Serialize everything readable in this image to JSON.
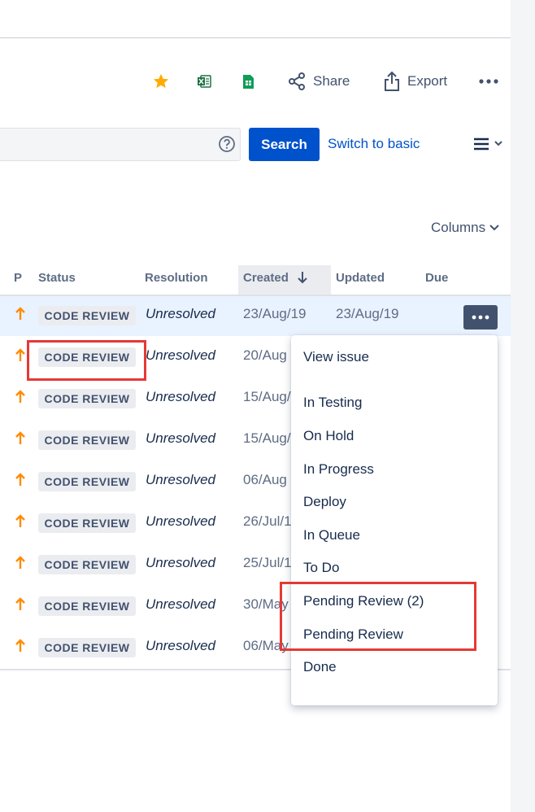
{
  "toolbar": {
    "share_label": "Share",
    "export_label": "Export"
  },
  "search": {
    "button_label": "Search",
    "switch_label": "Switch to basic"
  },
  "columns_label": "Columns",
  "table": {
    "headers": {
      "priority": "P",
      "status": "Status",
      "resolution": "Resolution",
      "created": "Created",
      "updated": "Updated",
      "due": "Due"
    },
    "rows": [
      {
        "status": "CODE REVIEW",
        "resolution": "Unresolved",
        "created": "23/Aug/19",
        "updated": "23/Aug/19"
      },
      {
        "status": "CODE REVIEW",
        "resolution": "Unresolved",
        "created": "20/Aug"
      },
      {
        "status": "CODE REVIEW",
        "resolution": "Unresolved",
        "created": "15/Aug/"
      },
      {
        "status": "CODE REVIEW",
        "resolution": "Unresolved",
        "created": "15/Aug/"
      },
      {
        "status": "CODE REVIEW",
        "resolution": "Unresolved",
        "created": "06/Aug"
      },
      {
        "status": "CODE REVIEW",
        "resolution": "Unresolved",
        "created": "26/Jul/1"
      },
      {
        "status": "CODE REVIEW",
        "resolution": "Unresolved",
        "created": "25/Jul/1"
      },
      {
        "status": "CODE REVIEW",
        "resolution": "Unresolved",
        "created": "30/May"
      },
      {
        "status": "CODE REVIEW",
        "resolution": "Unresolved",
        "created": "06/May"
      }
    ]
  },
  "menu": {
    "items": [
      "View issue",
      "In Testing",
      "On Hold",
      "In Progress",
      "Deploy",
      "In Queue",
      "To Do",
      "Pending Review (2)",
      "Pending Review",
      "Done"
    ]
  },
  "colors": {
    "primary": "#0052cc",
    "priority_arrow": "#ff8b00",
    "annotation": "#e53935"
  }
}
